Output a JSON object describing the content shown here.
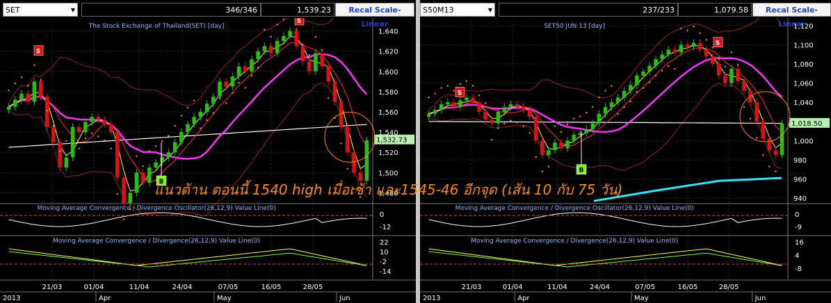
{
  "colors": {
    "up": "#22c40a",
    "down": "#e01010",
    "ma_magenta": "#ff33ff",
    "ma_white": "#ffffff",
    "ma_yellow": "#ffff66",
    "ma_red": "#ff3030",
    "band": "#8a2a10",
    "cyan": "#33e6ff",
    "overlay": "#ff8c00",
    "sar": "#ff8844",
    "grid": "#2a2a2a",
    "label_bg": "#b8f0b0"
  },
  "annotation": "แนวต้าน ตอนนี้ 1540  high เมื่อเช้า และ1545-46 อีกจุด (เส้น 10 กับ 75 วัน)",
  "panels": [
    {
      "symbol": "SET",
      "count": "346/346",
      "last_value": "1,539.23",
      "recal_label": "Recal Scale-Linear",
      "chart_title": "The Stock Exchange of Thailand(SET) [day]",
      "price_ticks": [
        "1,640",
        "1,620",
        "1,600",
        "1,580",
        "1,560",
        "1,540",
        "1,520",
        "1,500",
        "1,480"
      ],
      "price_label": "1,532.73",
      "sell_marker": "S",
      "buy_marker": "B",
      "macd_osc_title": "Moving Average Convergence / Divergence Oscillator(26,12,9) Value Line(0)",
      "macd_osc_ticks": [
        "0",
        "-12"
      ],
      "macd_title": "Moving Average Convergence / Divergence(26,12,9) Value Line(0)",
      "macd_ticks": [
        "22",
        "10",
        "-2",
        "-14"
      ],
      "date_ticks": [
        "21/03",
        "01/04",
        "11/04",
        "24/04",
        "07/05",
        "16/05",
        "28/05"
      ],
      "year": "2013",
      "months": [
        "Apr",
        "May",
        "Jun"
      ]
    },
    {
      "symbol": "S50M13",
      "count": "237/233",
      "last_value": "1,079.58",
      "recal_label": "Recal Scale-Linear",
      "chart_title": "SET50 JUN 13  [day]",
      "price_ticks": [
        "1,120",
        "1,100",
        "1,080",
        "1,060",
        "1,040",
        "1,020",
        "1,000",
        "980",
        "960",
        "940"
      ],
      "price_label": "1,018.50",
      "sell_marker": "S",
      "buy_marker": "B",
      "macd_osc_title": "Moving Average Convergence / Divergence Oscillator(26,12,9) Value Line(0)",
      "macd_osc_ticks": [
        "0",
        "-9"
      ],
      "macd_title": "Moving Average Convergence / Divergence(26,12,9) Value Line(0)",
      "macd_ticks": [
        "16",
        "4",
        "-8"
      ],
      "date_ticks": [
        "21/03",
        "01/04",
        "11/04",
        "24/04",
        "07/05",
        "16/05",
        "28/05"
      ],
      "year": "2013",
      "months": [
        "Apr",
        "May",
        "Jun"
      ]
    }
  ],
  "chart_data": [
    {
      "type": "candlestick",
      "title": "The Stock Exchange of Thailand(SET) [day]",
      "close": [
        1565,
        1572,
        1578,
        1570,
        1590,
        1575,
        1545,
        1530,
        1505,
        1515,
        1545,
        1540,
        1550,
        1555,
        1552,
        1548,
        1540,
        1495,
        1470,
        1480,
        1500,
        1490,
        1505,
        1510,
        1515,
        1520,
        1530,
        1540,
        1548,
        1555,
        1560,
        1568,
        1575,
        1590,
        1585,
        1595,
        1605,
        1600,
        1612,
        1620,
        1625,
        1618,
        1630,
        1635,
        1640,
        1625,
        1610,
        1600,
        1618,
        1605,
        1590,
        1570,
        1545,
        1520,
        1500,
        1492,
        1532
      ],
      "ylim": [
        1470,
        1650
      ],
      "x_ticks": [
        "21/03",
        "01/04",
        "11/04",
        "24/04",
        "07/05",
        "16/05",
        "28/05"
      ]
    },
    {
      "type": "candlestick",
      "title": "SET50 JUN 13  [day]",
      "close": [
        1028,
        1032,
        1038,
        1040,
        1035,
        1042,
        1045,
        1040,
        1030,
        1022,
        1018,
        1030,
        1035,
        1038,
        1036,
        1032,
        1025,
        1000,
        985,
        990,
        998,
        992,
        1000,
        1006,
        1008,
        1012,
        1018,
        1028,
        1035,
        1040,
        1045,
        1052,
        1058,
        1068,
        1072,
        1078,
        1085,
        1090,
        1095,
        1092,
        1100,
        1098,
        1102,
        1095,
        1088,
        1080,
        1068,
        1060,
        1075,
        1062,
        1052,
        1040,
        1020,
        1002,
        990,
        985,
        1018
      ],
      "ylim": [
        935,
        1125
      ],
      "x_ticks": [
        "21/03",
        "01/04",
        "11/04",
        "24/04",
        "07/05",
        "16/05",
        "28/05"
      ]
    }
  ]
}
